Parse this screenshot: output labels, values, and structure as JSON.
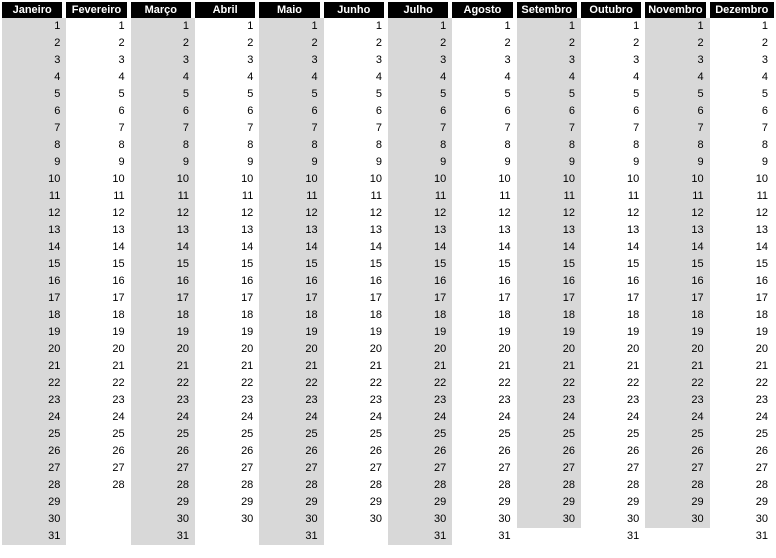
{
  "chart_data": {
    "type": "table",
    "title": "",
    "columns": [
      "Janeiro",
      "Fevereiro",
      "Março",
      "Abril",
      "Maio",
      "Junho",
      "Julho",
      "Agosto",
      "Setembro",
      "Outubro",
      "Novembro",
      "Dezembro"
    ],
    "month_lengths": [
      31,
      28,
      31,
      30,
      31,
      30,
      31,
      31,
      30,
      31,
      30,
      31
    ],
    "shaded_columns": [
      0,
      2,
      4,
      6,
      8,
      10
    ],
    "rows": 31
  }
}
